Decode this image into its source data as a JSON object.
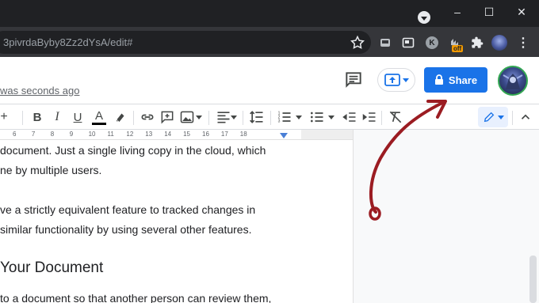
{
  "browser": {
    "url": "3pivrdaByby8Zz2dYsA/edit#",
    "window_controls": [
      "–",
      "☐",
      "✕"
    ],
    "extension_badge": "off",
    "profile_initial": "K"
  },
  "docs": {
    "save_status": "was seconds ago",
    "share_label": "Share"
  },
  "toolbar": {
    "plus": "+",
    "bold": "B",
    "italic": "I",
    "underline": "U",
    "text_color": "A"
  },
  "ruler": {
    "numbers": [
      "6",
      "7",
      "8",
      "9",
      "10",
      "11",
      "12",
      "13",
      "14",
      "15",
      "16",
      "17",
      "18"
    ]
  },
  "document": {
    "lines": [
      "document. Just a single living copy in the cloud, which",
      "ne by multiple users.",
      "ve a strictly equivalent feature to tracked changes in",
      "similar functionality by using several other features."
    ],
    "heading": "Your Document",
    "last_line": "to a document so that another person can review them,"
  },
  "colors": {
    "chrome_dark": "#202124",
    "share_blue": "#1a73e8",
    "annotation_arrow": "#9b1c22"
  }
}
